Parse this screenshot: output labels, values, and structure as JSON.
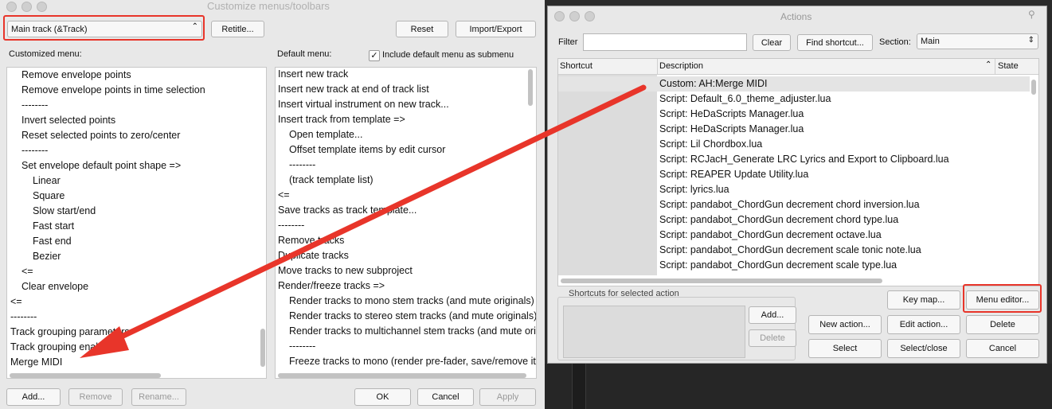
{
  "left": {
    "title": "Customize menus/toolbars",
    "menu_select": "Main track (&Track)",
    "retitle_label": "Retitle...",
    "reset_label": "Reset",
    "import_export_label": "Import/Export",
    "customized_label": "Customized menu:",
    "default_label": "Default menu:",
    "include_default_label": "Include default menu as submenu",
    "customized_items": [
      {
        "text": "Remove envelope points",
        "indent": 1
      },
      {
        "text": "Remove envelope points in time selection",
        "indent": 1
      },
      {
        "text": "--------",
        "indent": 1
      },
      {
        "text": "Invert selected points",
        "indent": 1
      },
      {
        "text": "Reset selected points to zero/center",
        "indent": 1
      },
      {
        "text": "--------",
        "indent": 1
      },
      {
        "text": "Set envelope default point shape =>",
        "indent": 1
      },
      {
        "text": "Linear",
        "indent": 2
      },
      {
        "text": "Square",
        "indent": 2
      },
      {
        "text": "Slow start/end",
        "indent": 2
      },
      {
        "text": "Fast start",
        "indent": 2
      },
      {
        "text": "Fast end",
        "indent": 2
      },
      {
        "text": "Bezier",
        "indent": 2
      },
      {
        "text": "<=",
        "indent": 1
      },
      {
        "text": "Clear envelope",
        "indent": 1
      },
      {
        "text": "<=",
        "indent": 0
      },
      {
        "text": "--------",
        "indent": 0
      },
      {
        "text": "Track grouping parameters",
        "indent": 0
      },
      {
        "text": "Track grouping enabled",
        "indent": 0
      },
      {
        "text": "Merge MIDI",
        "indent": 0
      }
    ],
    "default_items": [
      {
        "text": "Insert new track",
        "indent": 0
      },
      {
        "text": "Insert new track at end of track list",
        "indent": 0
      },
      {
        "text": "Insert virtual instrument on new track...",
        "indent": 0
      },
      {
        "text": "Insert track from template =>",
        "indent": 0
      },
      {
        "text": "Open template...",
        "indent": 1
      },
      {
        "text": "Offset template items by edit cursor",
        "indent": 1
      },
      {
        "text": "--------",
        "indent": 1
      },
      {
        "text": "(track template list)",
        "indent": 1
      },
      {
        "text": "<=",
        "indent": 0
      },
      {
        "text": "Save tracks as track template...",
        "indent": 0
      },
      {
        "text": "--------",
        "indent": 0
      },
      {
        "text": "Remove tracks",
        "indent": 0
      },
      {
        "text": "Duplicate tracks",
        "indent": 0
      },
      {
        "text": "Move tracks to new subproject",
        "indent": 0
      },
      {
        "text": "Render/freeze tracks =>",
        "indent": 0
      },
      {
        "text": "Render tracks to mono stem tracks (and mute originals)",
        "indent": 1
      },
      {
        "text": "Render tracks to stereo stem tracks (and mute originals)",
        "indent": 1
      },
      {
        "text": "Render tracks to multichannel stem tracks (and mute originals)",
        "indent": 1
      },
      {
        "text": "--------",
        "indent": 1
      },
      {
        "text": "Freeze tracks to mono (render pre-fader, save/remove items and FX)",
        "indent": 1
      }
    ],
    "add_label": "Add...",
    "remove_label": "Remove",
    "rename_label": "Rename...",
    "ok_label": "OK",
    "cancel_label": "Cancel",
    "apply_label": "Apply"
  },
  "right": {
    "title": "Actions",
    "filter_label": "Filter",
    "filter_value": "",
    "clear_label": "Clear",
    "find_shortcut_label": "Find shortcut...",
    "section_label": "Section:",
    "section_value": "Main",
    "col_shortcut": "Shortcut",
    "col_description": "Description",
    "col_state": "State",
    "actions": [
      "Custom: AH:Merge MIDI",
      "Script: Default_6.0_theme_adjuster.lua",
      "Script: HeDaScripts Manager.lua",
      "Script: HeDaScripts Manager.lua",
      "Script: Lil Chordbox.lua",
      "Script: RCJacH_Generate LRC Lyrics and Export to Clipboard.lua",
      "Script: REAPER Update Utility.lua",
      "Script: lyrics.lua",
      "Script: pandabot_ChordGun decrement chord inversion.lua",
      "Script: pandabot_ChordGun decrement chord type.lua",
      "Script: pandabot_ChordGun decrement octave.lua",
      "Script: pandabot_ChordGun decrement scale tonic note.lua",
      "Script: pandabot_ChordGun decrement scale type.lua"
    ],
    "shortcuts_label": "Shortcuts for selected action",
    "add_label": "Add...",
    "delete_small_label": "Delete",
    "key_map_label": "Key map...",
    "menu_editor_label": "Menu editor...",
    "new_action_label": "New action...",
    "edit_action_label": "Edit action...",
    "delete_label": "Delete",
    "select_label": "Select",
    "select_close_label": "Select/close",
    "cancel_label": "Cancel"
  },
  "colors": {
    "annotation": "#e8352a",
    "window_bg": "#e8e8e8",
    "selected_row": "#dcdcdc"
  }
}
